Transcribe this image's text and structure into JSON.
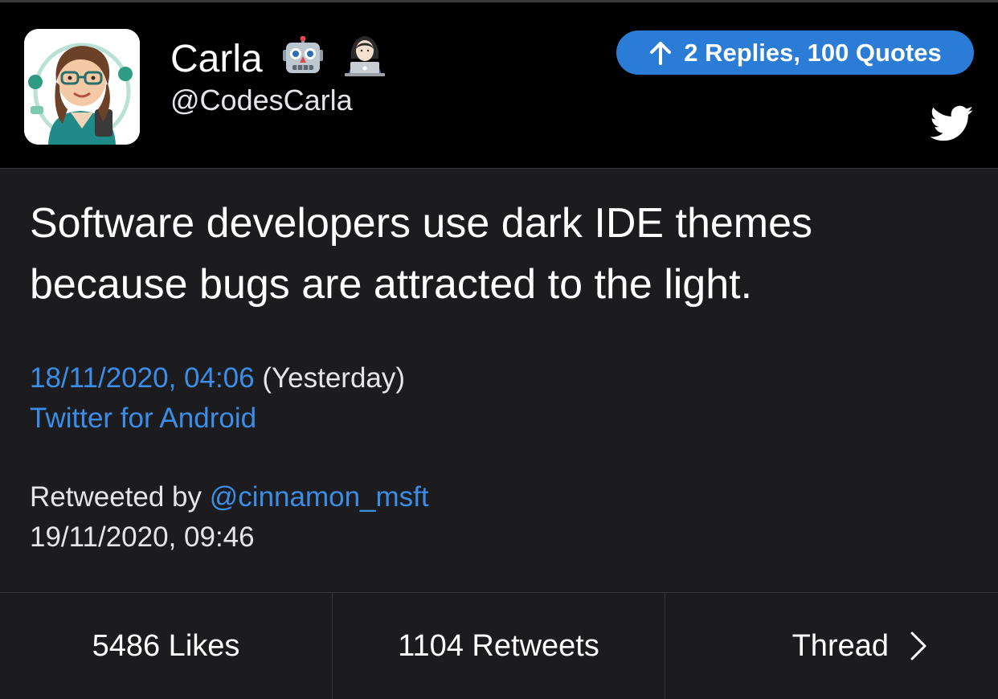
{
  "tweet": {
    "author": {
      "display_name": "Carla",
      "handle": "@CodesCarla",
      "name_emojis": [
        "robot-emoji",
        "technologist-emoji"
      ]
    },
    "replies_badge": "2 Replies, 100 Quotes",
    "text_line1": "Software developers use dark IDE themes",
    "text_line2": "because bugs are attracted to the light.",
    "timestamp": "18/11/2020, 04:06",
    "relative_time": "(Yesterday)",
    "source": "Twitter for Android",
    "retweeted_by_label": "Retweeted by",
    "retweeted_by_handle": "@cinnamon_msft",
    "retweet_time": "19/11/2020, 09:46"
  },
  "footer": {
    "likes": "5486 Likes",
    "retweets": "1104 Retweets",
    "thread": "Thread"
  },
  "colors": {
    "background": "#1c1c1e",
    "header": "#000000",
    "accent": "#2a7cd6",
    "link": "#3b8de8",
    "twitter_bird": "#ffffff"
  },
  "icons": {
    "up_arrow": "arrow-up-icon",
    "twitter": "twitter-bird-icon",
    "chevron": "chevron-right-icon"
  }
}
